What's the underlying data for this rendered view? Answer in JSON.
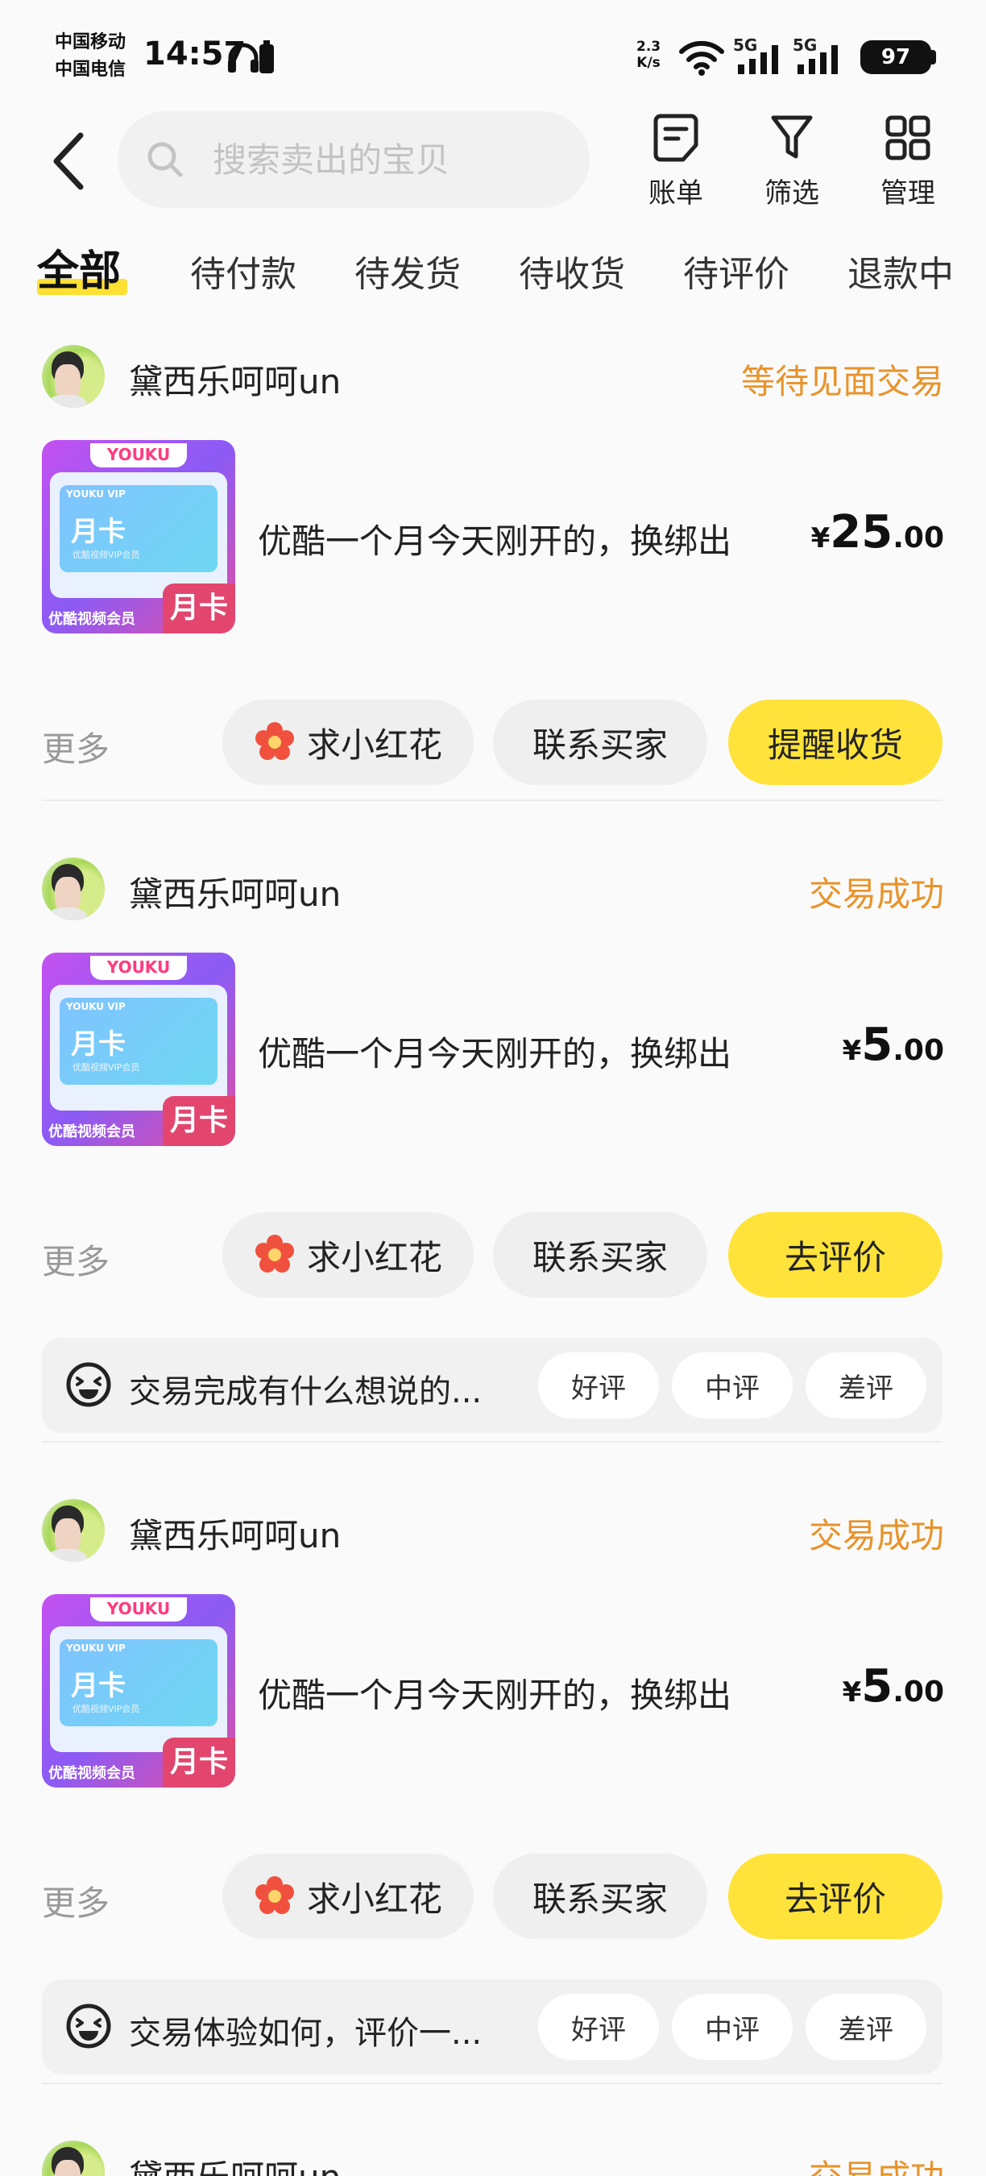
{
  "status_bar": {
    "carrier_1": "中国移动",
    "carrier_2": "中国电信",
    "time": "14:57",
    "speed_value": "2.3",
    "speed_unit": "K/s",
    "network_1": "5G",
    "network_2": "5G",
    "battery": "97"
  },
  "header": {
    "search_placeholder": "搜索卖出的宝贝",
    "bill_label": "账单",
    "filter_label": "筛选",
    "manage_label": "管理"
  },
  "tabs": [
    {
      "label": "全部",
      "active": true
    },
    {
      "label": "待付款"
    },
    {
      "label": "待发货"
    },
    {
      "label": "待收货"
    },
    {
      "label": "待评价"
    },
    {
      "label": "退款中"
    }
  ],
  "thumbnail": {
    "brand": "YOUKU",
    "vip": "YOUKU VIP",
    "card_title": "月卡",
    "card_sub": "优酷视频VIP会员",
    "footer": "优酷视频会员",
    "tag": "月卡"
  },
  "orders": [
    {
      "seller": "黛西乐呵呵un",
      "status": "等待见面交易",
      "title": "优酷一个月今天刚开的，换绑出",
      "price_currency": "¥",
      "price_int": "25",
      "price_dec": ".00",
      "more": "更多",
      "flower_btn": "求小红花",
      "contact_btn": "联系买家",
      "primary_btn": "提醒收货"
    },
    {
      "seller": "黛西乐呵呵un",
      "status": "交易成功",
      "title": "优酷一个月今天刚开的，换绑出",
      "price_currency": "¥",
      "price_int": "5",
      "price_dec": ".00",
      "more": "更多",
      "flower_btn": "求小红花",
      "contact_btn": "联系买家",
      "primary_btn": "去评价",
      "review_prompt": "交易完成有什么想说的...",
      "review_good": "好评",
      "review_mid": "中评",
      "review_bad": "差评"
    },
    {
      "seller": "黛西乐呵呵un",
      "status": "交易成功",
      "title": "优酷一个月今天刚开的，换绑出",
      "price_currency": "¥",
      "price_int": "5",
      "price_dec": ".00",
      "more": "更多",
      "flower_btn": "求小红花",
      "contact_btn": "联系买家",
      "primary_btn": "去评价",
      "review_prompt": "交易体验如何，评价一...",
      "review_good": "好评",
      "review_mid": "中评",
      "review_bad": "差评"
    },
    {
      "seller": "黛西乐呵呵un",
      "status": "交易成功"
    }
  ],
  "colors": {
    "accent_yellow": "#ffe33a",
    "status_orange": "#e8932a",
    "flower_red": "#f0513e"
  }
}
